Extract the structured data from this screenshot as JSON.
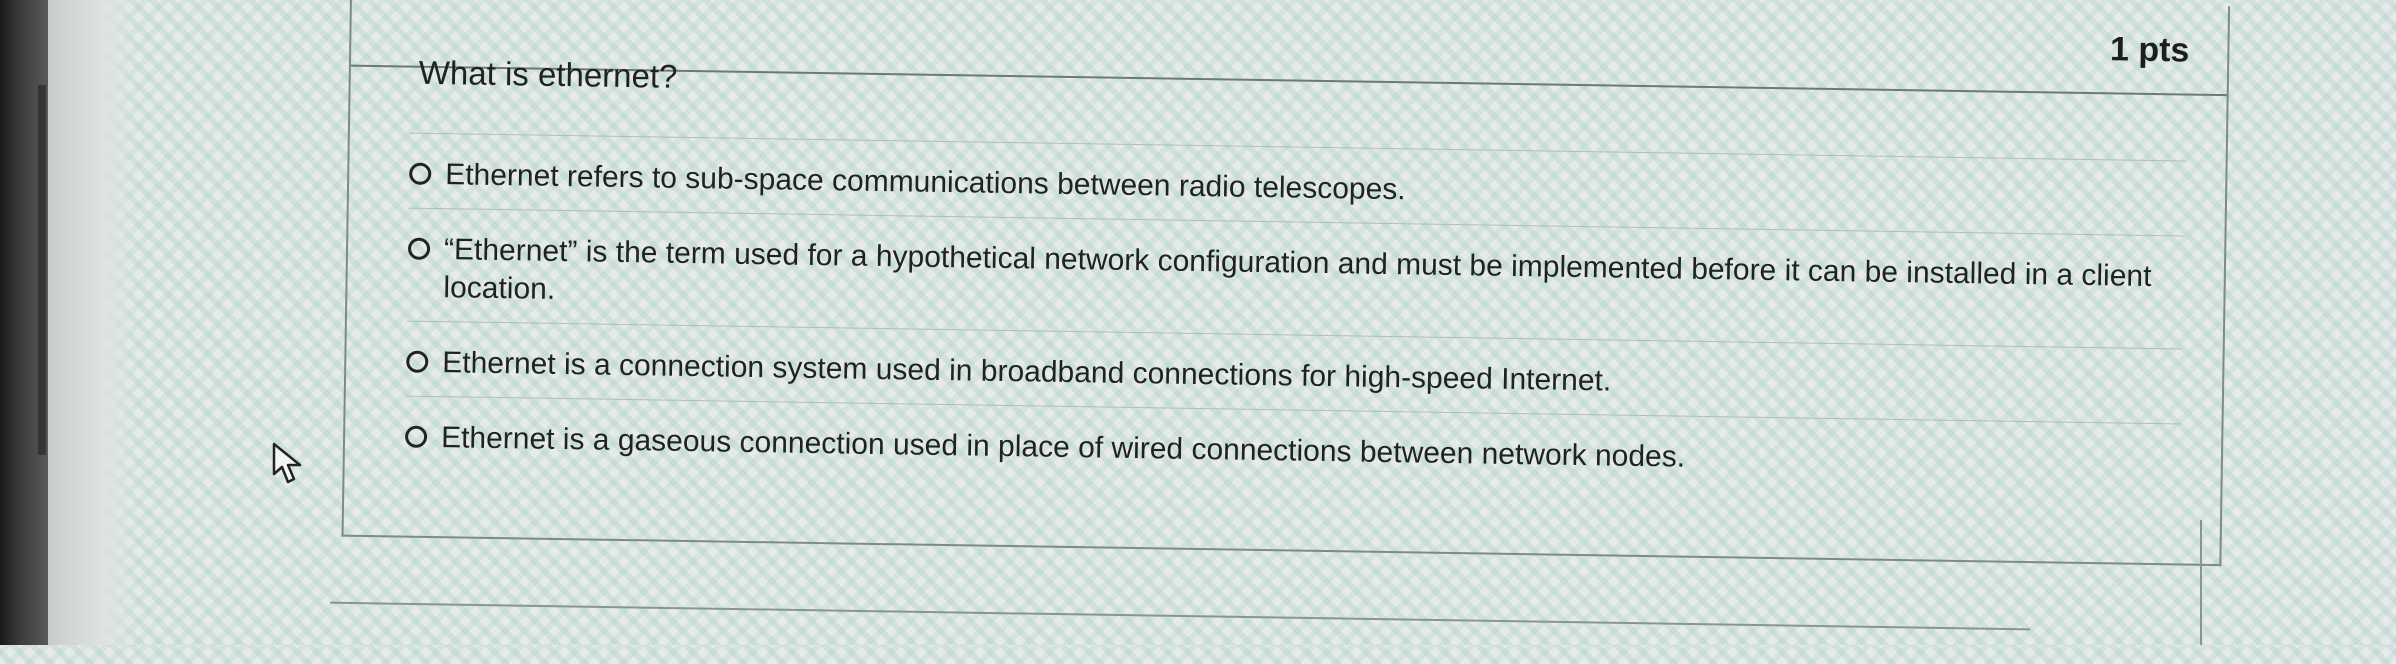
{
  "question": {
    "points_label": "1 pts",
    "prompt": "What is ethernet?",
    "options": [
      {
        "label": "Ethernet refers to sub-space communications between radio telescopes."
      },
      {
        "label": "“Ethernet” is the term used for a hypothetical network configuration and must be implemented before it can be installed in a client location."
      },
      {
        "label": "Ethernet is a connection system used in broadband connections for high-speed Internet."
      },
      {
        "label": "Ethernet is a gaseous connection used in place of wired connections between network nodes."
      }
    ]
  },
  "icons": {
    "cursor": "mouse-pointer-icon",
    "radio": "radio-unselected-icon"
  }
}
